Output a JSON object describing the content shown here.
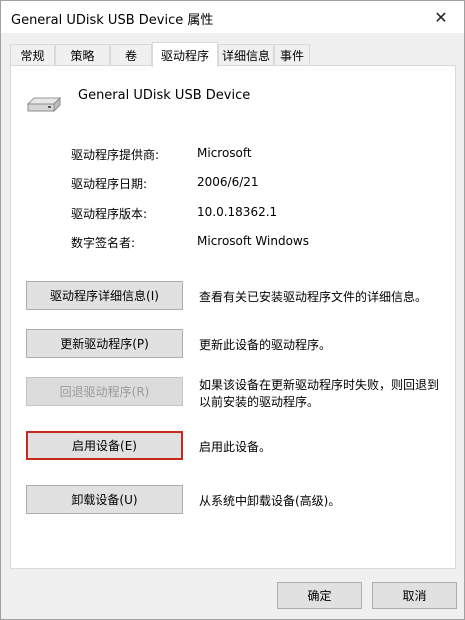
{
  "window": {
    "title": "General UDisk USB Device 属性",
    "close_glyph": "✕"
  },
  "tabs": [
    {
      "label": "常规"
    },
    {
      "label": "策略"
    },
    {
      "label": "卷"
    },
    {
      "label": "驱动程序",
      "active": true
    },
    {
      "label": "详细信息"
    },
    {
      "label": "事件"
    }
  ],
  "device": {
    "name": "General UDisk USB Device",
    "icon": "usb-drive-icon"
  },
  "properties": [
    {
      "label": "驱动程序提供商:",
      "value": "Microsoft"
    },
    {
      "label": "驱动程序日期:",
      "value": "2006/6/21"
    },
    {
      "label": "驱动程序版本:",
      "value": "10.0.18362.1"
    },
    {
      "label": "数字签名者:",
      "value": "Microsoft Windows"
    }
  ],
  "actions": [
    {
      "label": "驱动程序详细信息(I)",
      "desc_line1": "查看有关已安装驱动程序文件的详细信息。",
      "desc_line2": ""
    },
    {
      "label": "更新驱动程序(P)",
      "desc_line1": "更新此设备的驱动程序。",
      "desc_line2": ""
    },
    {
      "label": "回退驱动程序(R)",
      "desc_line1": "如果该设备在更新驱动程序时失败，则回退到",
      "desc_line2": "以前安装的驱动程序。",
      "disabled": true
    },
    {
      "label": "启用设备(E)",
      "desc_line1": "启用此设备。",
      "desc_line2": "",
      "focused": true
    },
    {
      "label": "卸载设备(U)",
      "desc_line1": "从系统中卸载设备(高级)。",
      "desc_line2": ""
    }
  ],
  "footer": {
    "ok_label": "确定",
    "cancel_label": "取消"
  }
}
